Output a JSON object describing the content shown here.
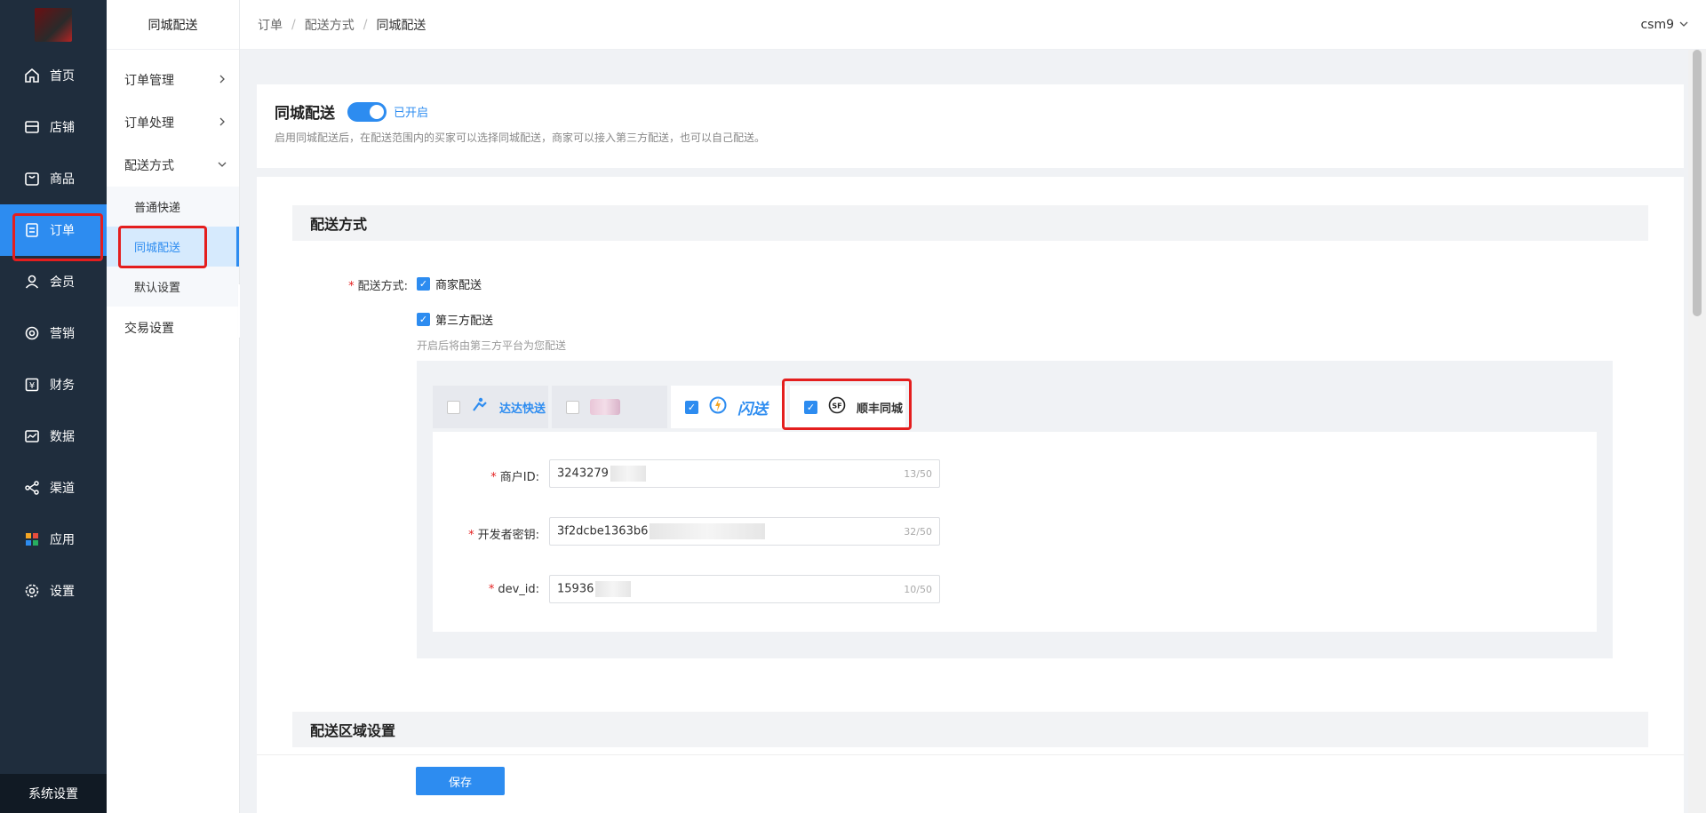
{
  "sidebar": {
    "items": [
      {
        "label": "首页",
        "icon": "home-icon"
      },
      {
        "label": "店铺",
        "icon": "shop-icon"
      },
      {
        "label": "商品",
        "icon": "goods-icon"
      },
      {
        "label": "订单",
        "icon": "order-icon"
      },
      {
        "label": "会员",
        "icon": "user-icon"
      },
      {
        "label": "营销",
        "icon": "marketing-icon"
      },
      {
        "label": "财务",
        "icon": "finance-icon"
      },
      {
        "label": "数据",
        "icon": "data-icon"
      },
      {
        "label": "渠道",
        "icon": "channel-icon"
      },
      {
        "label": "应用",
        "icon": "apps-icon"
      },
      {
        "label": "设置",
        "icon": "settings-icon"
      }
    ],
    "bottom_label": "系统设置"
  },
  "subnav": {
    "title": "同城配送",
    "items": [
      {
        "label": "订单管理"
      },
      {
        "label": "订单处理"
      },
      {
        "label": "配送方式"
      },
      {
        "label": "交易设置"
      }
    ],
    "children": [
      {
        "label": "普通快递"
      },
      {
        "label": "同城配送"
      },
      {
        "label": "默认设置"
      }
    ]
  },
  "header": {
    "breadcrumb": [
      "订单",
      "配送方式",
      "同城配送"
    ],
    "user": "csm9"
  },
  "top_card": {
    "title": "同城配送",
    "switch_label": "已开启",
    "description": "启用同城配送后，在配送范围内的买家可以选择同城配送，商家可以接入第三方配送，也可以自己配送。"
  },
  "delivery": {
    "section_title": "配送方式",
    "label": "配送方式:",
    "option_merchant": "商家配送",
    "option_third": "第三方配送",
    "third_hint": "开启后将由第三方平台为您配送",
    "providers": [
      {
        "name": "达达快送",
        "checked": false
      },
      {
        "name": "",
        "checked": false
      },
      {
        "name": "闪送",
        "checked": true
      },
      {
        "name": "顺丰同城",
        "checked": true
      }
    ],
    "fields": [
      {
        "label": "商户ID:",
        "value": "3243279",
        "count": "13/50"
      },
      {
        "label": "开发者密钥:",
        "value": "3f2dcbe1363b6",
        "count": "32/50"
      },
      {
        "label": "dev_id:",
        "value": "15936",
        "count": "10/50"
      }
    ]
  },
  "area": {
    "section_title": "配送区域设置"
  },
  "footer": {
    "save_label": "保存"
  },
  "colors": {
    "accent": "#2d8cf0",
    "sidebar_bg": "#1f2d3d",
    "highlight": "#e41e1e"
  }
}
